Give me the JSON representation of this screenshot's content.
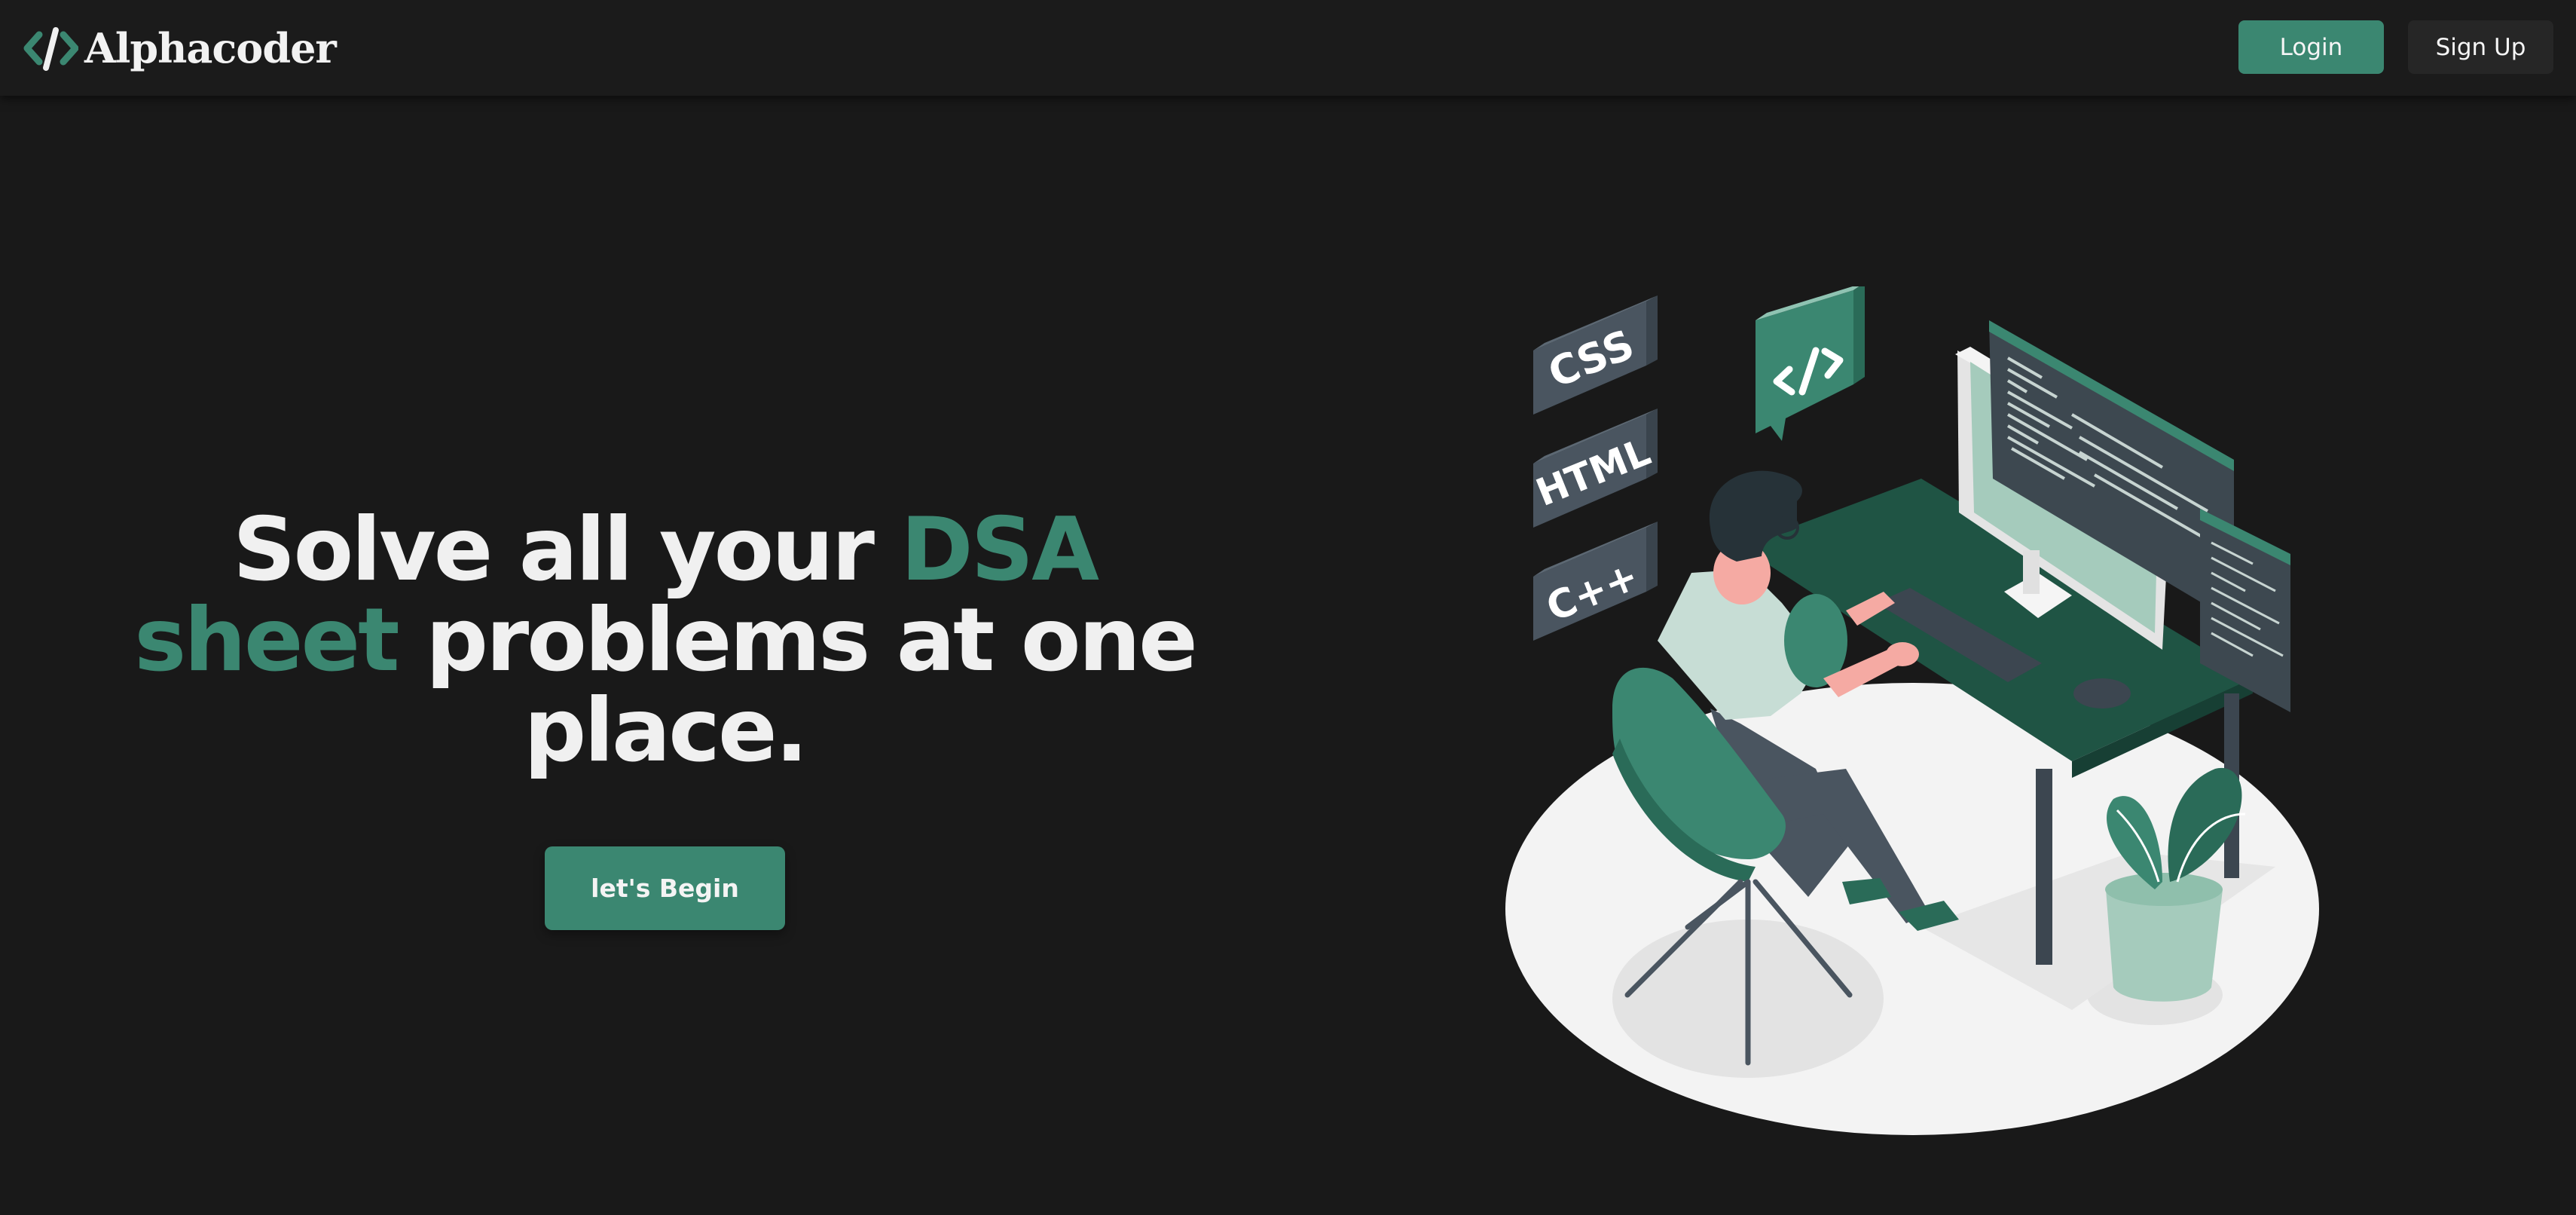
{
  "navbar": {
    "brand": {
      "name": "Alphacoder",
      "icon": "code-brackets-icon"
    },
    "login_label": "Login",
    "signup_label": "Sign Up"
  },
  "hero": {
    "headline": {
      "part1": "Solve all your ",
      "accent1": "DSA",
      "accent2": "sheet",
      "part2": " problems at one",
      "line3": "place."
    },
    "cta_label": "let's Begin"
  },
  "illustration": {
    "tiles": [
      "CSS",
      "HTML",
      "C++"
    ],
    "bubble_icon": "code-brackets-icon"
  },
  "colors": {
    "background": "#191919",
    "navbar": "#1b1b1b",
    "accent": "#3b8771",
    "text": "#f0f0f0",
    "secondary_button": "#262626"
  }
}
